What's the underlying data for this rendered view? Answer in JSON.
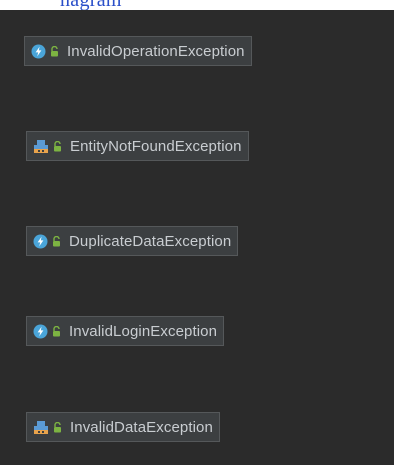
{
  "header_strip": {
    "partial_text": "nagram"
  },
  "diagram": {
    "nodes": [
      {
        "label": "InvalidOperationException",
        "kind": "exception-class",
        "icon": "exception-class-icon",
        "visibility_icon": "public-lock-icon"
      },
      {
        "label": "EntityNotFoundException",
        "kind": "class",
        "icon": "class-icon",
        "visibility_icon": "public-lock-icon"
      },
      {
        "label": "DuplicateDataException",
        "kind": "exception-class",
        "icon": "exception-class-icon",
        "visibility_icon": "public-lock-icon"
      },
      {
        "label": "InvalidLoginException",
        "kind": "exception-class",
        "icon": "exception-class-icon",
        "visibility_icon": "public-lock-icon"
      },
      {
        "label": "InvalidDataException",
        "kind": "class",
        "icon": "class-icon",
        "visibility_icon": "public-lock-icon"
      }
    ]
  },
  "colors": {
    "background": "#2b2b2b",
    "node_fill": "#3c3f41",
    "node_border": "#55585a",
    "label": "#c9cdd1",
    "exception_icon": "#4aa5d9",
    "lock_icon": "#7cb342",
    "class_icon_blue": "#5b9bd5",
    "class_icon_orange": "#e8a34c"
  }
}
